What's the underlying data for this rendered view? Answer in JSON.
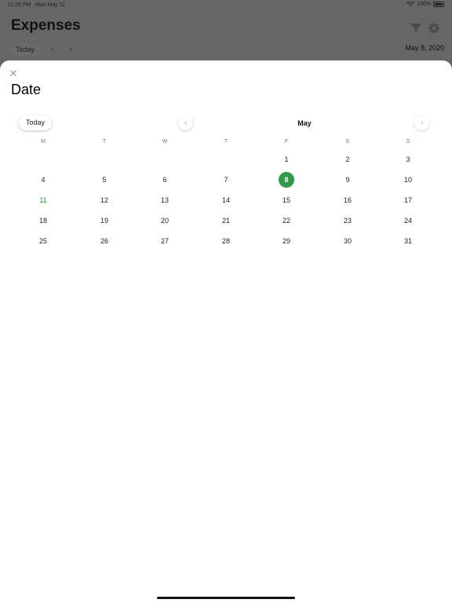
{
  "status_bar": {
    "time": "11:25 PM",
    "date": "Mon May 11",
    "battery": "100%"
  },
  "background": {
    "title": "Expenses",
    "today_label": "Today",
    "prev_label": "‹",
    "next_label": "›",
    "selected_date": "May 8, 2020"
  },
  "sheet": {
    "close_label": "✕",
    "title": "Date",
    "today_label": "Today",
    "prev_label": "‹",
    "next_label": "›",
    "month": "May",
    "weekdays": [
      "M",
      "T",
      "W",
      "T",
      "F",
      "S",
      "S"
    ],
    "weeks": [
      [
        "",
        "",
        "",
        "",
        "1",
        "2",
        "3"
      ],
      [
        "4",
        "5",
        "6",
        "7",
        "8",
        "9",
        "10"
      ],
      [
        "11",
        "12",
        "13",
        "14",
        "15",
        "16",
        "17"
      ],
      [
        "18",
        "19",
        "20",
        "21",
        "22",
        "23",
        "24"
      ],
      [
        "25",
        "26",
        "27",
        "28",
        "29",
        "30",
        "31"
      ]
    ],
    "selected_day": "8",
    "today_day": "11"
  },
  "colors": {
    "accent": "#2f9a48",
    "today_text": "#2e8b3e",
    "backdrop": "#666666"
  }
}
